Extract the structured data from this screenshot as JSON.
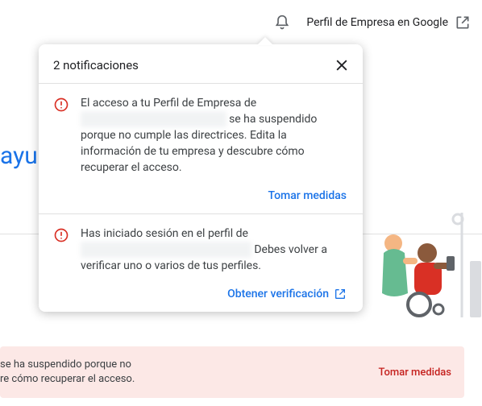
{
  "topbar": {
    "external_label": "Perfil de Empresa en Google"
  },
  "popover": {
    "title": "2 notificaciones"
  },
  "notif1": {
    "pre": "El acceso a tu Perfil de Empresa de ",
    "redacted": "xxxxxxx xxxxxxxxxx xxxxxxxx",
    "post": " se ha suspendido porque no cumple las directrices. Edita la información de tu empresa y descubre cómo recuperar el acceso.",
    "action": "Tomar medidas"
  },
  "notif2": {
    "pre": "Has iniciado sesión en el perfil de ",
    "redacted": "xxxxxxx xxxxxxxxxx xxxxxxxx xxxx",
    "post": " Debes volver a verificar uno o varios de tus perfiles.",
    "action": "Obtener verificación"
  },
  "behind_text": "ayu",
  "warn_banner": {
    "line1": " se ha suspendido porque no",
    "line2": "re cómo recuperar el acceso.",
    "action": "Tomar medidas"
  }
}
